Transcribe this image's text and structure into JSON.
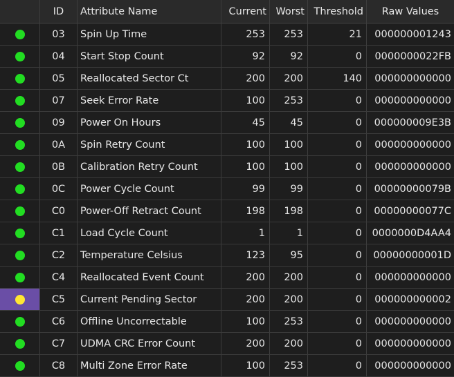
{
  "headers": {
    "status": "",
    "id": "ID",
    "name": "Attribute Name",
    "current": "Current",
    "worst": "Worst",
    "threshold": "Threshold",
    "raw": "Raw Values"
  },
  "colors": {
    "good": "#22dd22",
    "caution": "#ffe633",
    "selected_row_status_bg": "#6a4ea6"
  },
  "rows": [
    {
      "status": "good",
      "id": "03",
      "name": "Spin Up Time",
      "current": "253",
      "worst": "253",
      "threshold": "21",
      "raw": "000000001243"
    },
    {
      "status": "good",
      "id": "04",
      "name": "Start Stop Count",
      "current": "92",
      "worst": "92",
      "threshold": "0",
      "raw": "0000000022FB"
    },
    {
      "status": "good",
      "id": "05",
      "name": "Reallocated Sector Ct",
      "current": "200",
      "worst": "200",
      "threshold": "140",
      "raw": "000000000000"
    },
    {
      "status": "good",
      "id": "07",
      "name": "Seek Error Rate",
      "current": "100",
      "worst": "253",
      "threshold": "0",
      "raw": "000000000000"
    },
    {
      "status": "good",
      "id": "09",
      "name": "Power On Hours",
      "current": "45",
      "worst": "45",
      "threshold": "0",
      "raw": "000000009E3B"
    },
    {
      "status": "good",
      "id": "0A",
      "name": "Spin Retry Count",
      "current": "100",
      "worst": "100",
      "threshold": "0",
      "raw": "000000000000"
    },
    {
      "status": "good",
      "id": "0B",
      "name": "Calibration Retry Count",
      "current": "100",
      "worst": "100",
      "threshold": "0",
      "raw": "000000000000"
    },
    {
      "status": "good",
      "id": "0C",
      "name": "Power Cycle Count",
      "current": "99",
      "worst": "99",
      "threshold": "0",
      "raw": "00000000079B"
    },
    {
      "status": "good",
      "id": "C0",
      "name": "Power-Off Retract Count",
      "current": "198",
      "worst": "198",
      "threshold": "0",
      "raw": "00000000077C"
    },
    {
      "status": "good",
      "id": "C1",
      "name": "Load Cycle Count",
      "current": "1",
      "worst": "1",
      "threshold": "0",
      "raw": "0000000D4AA4"
    },
    {
      "status": "good",
      "id": "C2",
      "name": "Temperature Celsius",
      "current": "123",
      "worst": "95",
      "threshold": "0",
      "raw": "00000000001D"
    },
    {
      "status": "good",
      "id": "C4",
      "name": "Reallocated Event Count",
      "current": "200",
      "worst": "200",
      "threshold": "0",
      "raw": "000000000000"
    },
    {
      "status": "caution",
      "selected": true,
      "id": "C5",
      "name": "Current Pending Sector",
      "current": "200",
      "worst": "200",
      "threshold": "0",
      "raw": "000000000002"
    },
    {
      "status": "good",
      "id": "C6",
      "name": "Offline Uncorrectable",
      "current": "100",
      "worst": "253",
      "threshold": "0",
      "raw": "000000000000"
    },
    {
      "status": "good",
      "id": "C7",
      "name": "UDMA CRC Error Count",
      "current": "200",
      "worst": "200",
      "threshold": "0",
      "raw": "000000000000"
    },
    {
      "status": "good",
      "id": "C8",
      "name": "Multi Zone Error Rate",
      "current": "100",
      "worst": "253",
      "threshold": "0",
      "raw": "000000000000"
    }
  ]
}
